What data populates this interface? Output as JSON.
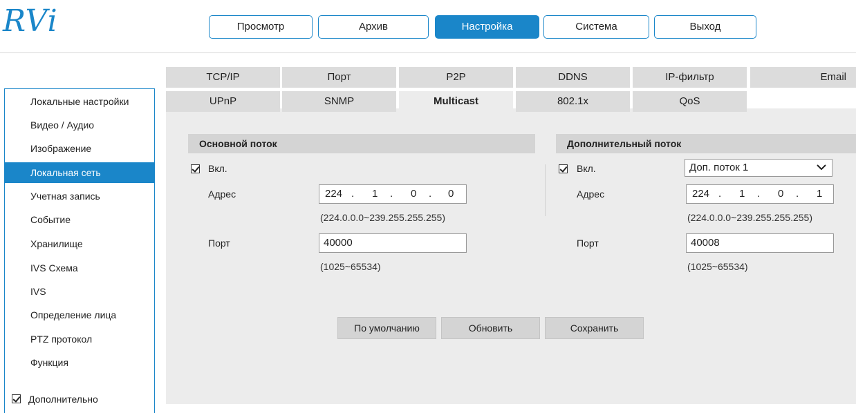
{
  "brand": {
    "logo_text": "RVi",
    "accent": "#1a86c9"
  },
  "topnav": [
    {
      "label": "Просмотр",
      "active": false
    },
    {
      "label": "Архив",
      "active": false
    },
    {
      "label": "Настройка",
      "active": true
    },
    {
      "label": "Система",
      "active": false
    },
    {
      "label": "Выход",
      "active": false
    }
  ],
  "sidebar": {
    "items": [
      "Локальные настройки",
      "Видео / Аудио",
      "Изображение",
      "Локальная сеть",
      "Учетная запись",
      "Событие",
      "Хранилище",
      "IVS Схема",
      "IVS",
      "Определение лица",
      "PTZ протокол",
      "Функция"
    ],
    "active_index": 3,
    "advanced_label": "Дополнительно",
    "advanced_checked": true
  },
  "tabs": {
    "row1": [
      "TCP/IP",
      "Порт",
      "P2P",
      "DDNS",
      "IP-фильтр",
      "Email"
    ],
    "row2": [
      "UPnP",
      "SNMP",
      "Multicast",
      "802.1x",
      "QoS"
    ],
    "active": "Multicast"
  },
  "main_stream": {
    "title": "Основной поток",
    "enable_label": "Вкл.",
    "enabled": true,
    "address_label": "Адрес",
    "address": [
      "224",
      "1",
      "0",
      "0"
    ],
    "address_range": "(224.0.0.0~239.255.255.255)",
    "port_label": "Порт",
    "port": "40000",
    "port_range": "(1025~65534)"
  },
  "sub_stream": {
    "title": "Дополнительный поток",
    "enable_label": "Вкл.",
    "enabled": true,
    "stream_select": "Доп. поток 1",
    "address_label": "Адрес",
    "address": [
      "224",
      "1",
      "0",
      "1"
    ],
    "address_range": "(224.0.0.0~239.255.255.255)",
    "port_label": "Порт",
    "port": "40008",
    "port_range": "(1025~65534)"
  },
  "actions": {
    "default_label": "По умолчанию",
    "refresh_label": "Обновить",
    "save_label": "Сохранить"
  }
}
